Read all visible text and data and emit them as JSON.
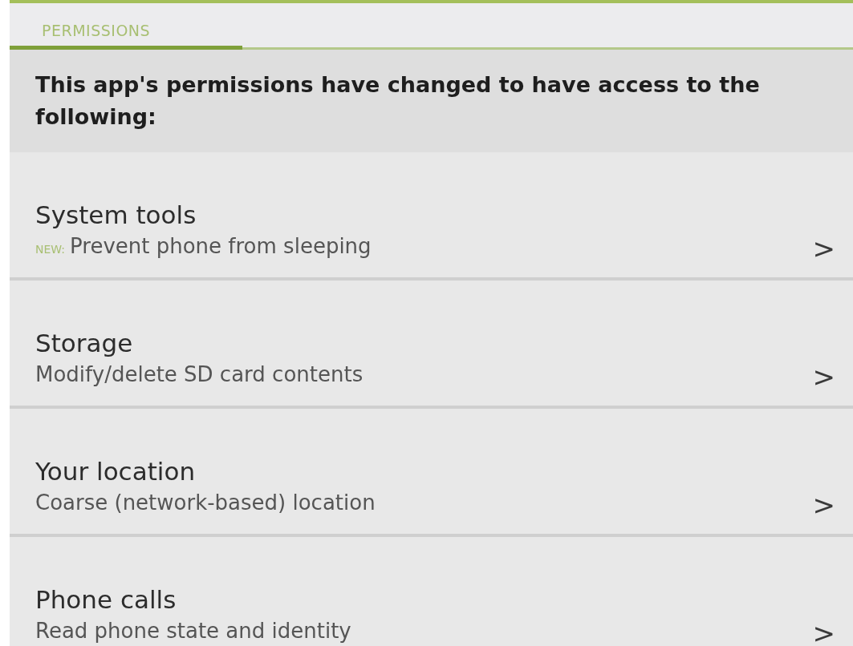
{
  "tabs": [
    {
      "label": "PERMISSIONS",
      "selected": true
    }
  ],
  "header": {
    "text": "This app's permissions have changed to have access to the following:"
  },
  "permissions": [
    {
      "title": "System tools",
      "badge": "NEW:",
      "description": "Prevent phone from sleeping",
      "chevron": ">"
    },
    {
      "title": "Storage",
      "description": "Modify/delete SD card contents",
      "chevron": ">"
    },
    {
      "title": "Your location",
      "description": "Coarse (network-based) location",
      "chevron": ">"
    },
    {
      "title": "Phone calls",
      "description": "Read phone state and identity",
      "chevron": ">"
    }
  ]
}
